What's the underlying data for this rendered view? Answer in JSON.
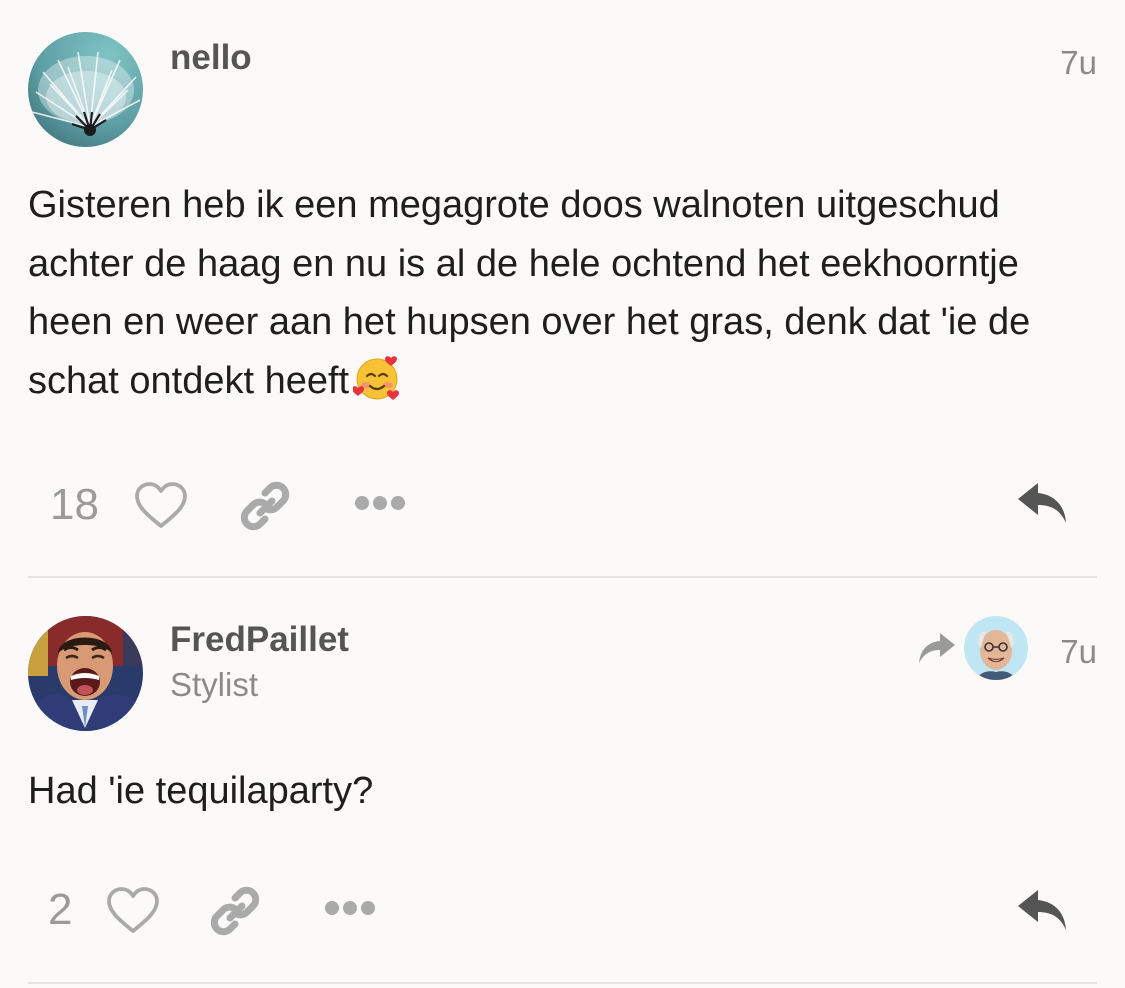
{
  "posts": [
    {
      "username": "nello",
      "timestamp": "7u",
      "avatar_icon": "dandelion-avatar",
      "body": "Gisteren heb ik een megagrote doos walnoten uitgeschud achter de haag en nu is al de hele ochtend het eekhoorntje heen en weer aan het hupsen over het gras, denk dat 'ie de schat ontdekt heeft",
      "emoji": "smiling-face-with-hearts-emoji",
      "likes": "18",
      "actions": [
        "heart-icon",
        "link-icon",
        "more-icon",
        "reply-icon"
      ]
    },
    {
      "username": "FredPaillet",
      "user_title": "Stylist",
      "timestamp": "7u",
      "avatar_icon": "laughing-man-avatar",
      "reply_to_icon": "share-arrow-icon",
      "reply_to_avatar": "smiling-man-avatar",
      "body": "Had 'ie tequilaparty?",
      "likes": "2",
      "actions": [
        "heart-icon",
        "link-icon",
        "more-icon",
        "reply-icon"
      ]
    }
  ],
  "colors": {
    "background": "#fbfaf8",
    "text": "#1e1e1e",
    "muted": "#8b8b8b",
    "username": "#555555",
    "icon": "#aaaaaa",
    "reply_icon": "#555555",
    "divider": "#e6e4e1"
  }
}
